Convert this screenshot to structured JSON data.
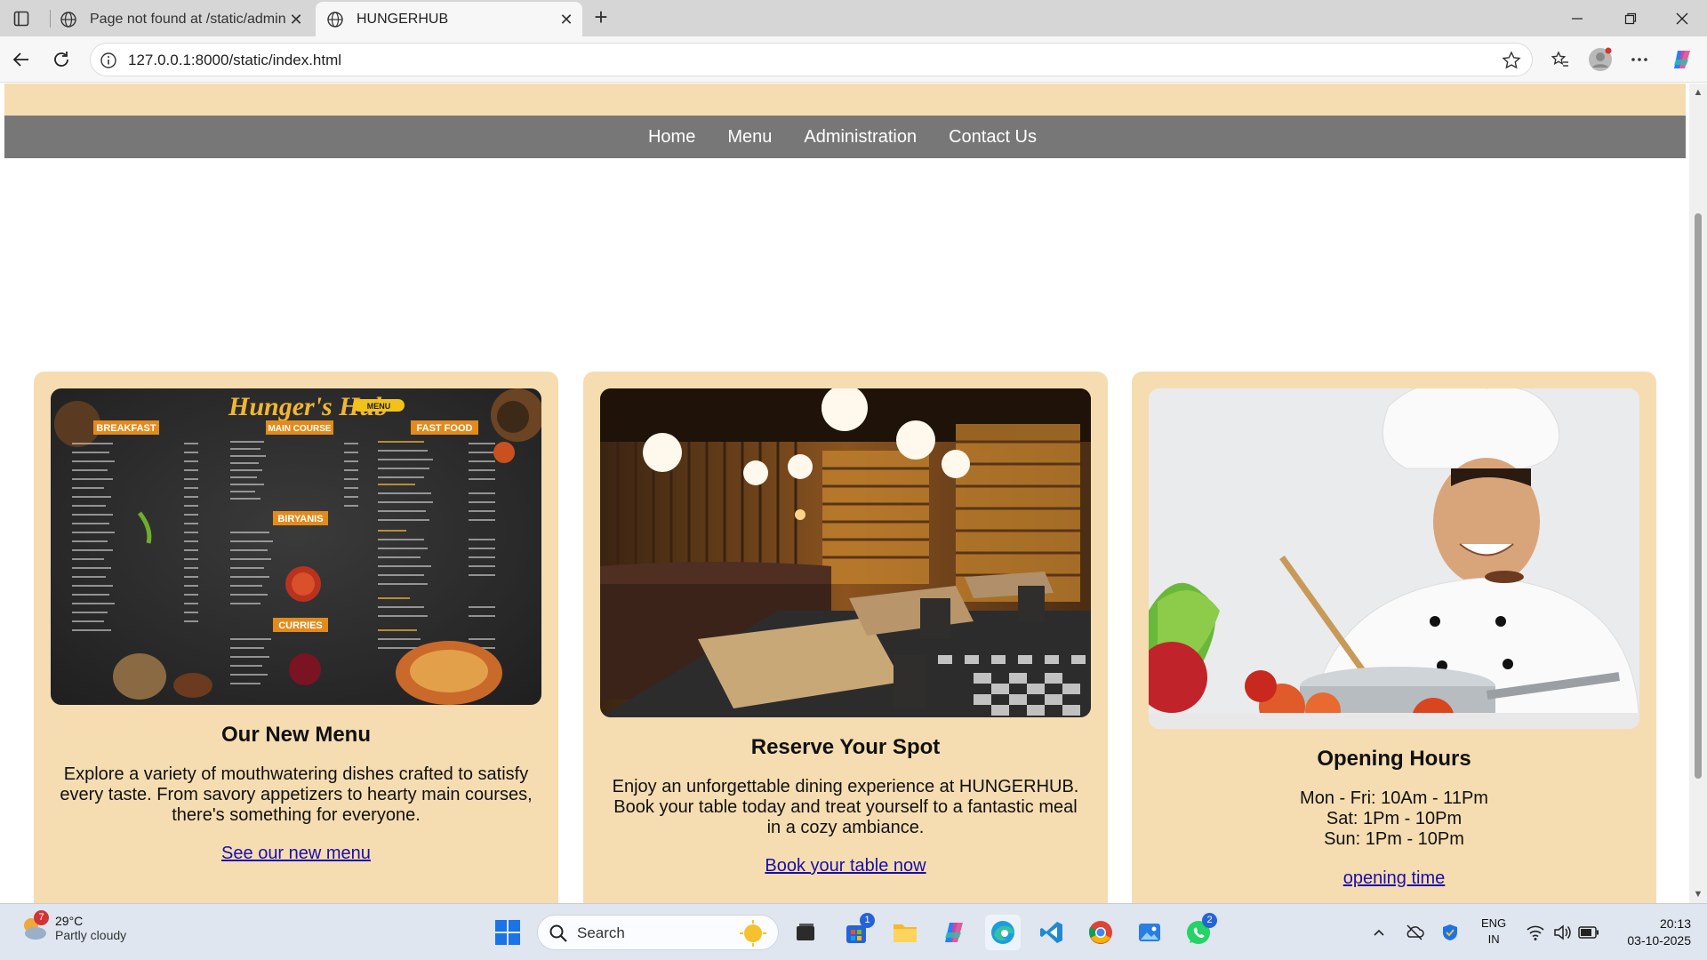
{
  "browser": {
    "tabs": [
      {
        "title": "Page not found at /static/adminstr",
        "active": false
      },
      {
        "title": "HUNGERHUB",
        "active": true
      }
    ],
    "url": "127.0.0.1:8000/static/index.html"
  },
  "nav": {
    "items": [
      "Home",
      "Menu",
      "Administration",
      "Contact Us"
    ]
  },
  "cards": [
    {
      "title": "Our New Menu",
      "text": "Explore a variety of mouthwatering dishes crafted to satisfy every taste. From savory appetizers to hearty main courses, there's something for everyone.",
      "link": "See our new menu",
      "image": "restaurant-menu-board-image"
    },
    {
      "title": "Reserve Your Spot",
      "text": "Enjoy an unforgettable dining experience at HUNGERHUB. Book your table today and treat yourself to a fantastic meal in a cozy ambiance.",
      "link": "Book your table now",
      "image": "restaurant-interior-image"
    },
    {
      "title": "Opening Hours",
      "hours": [
        "Mon - Fri: 10Am - 11Pm",
        "Sat: 1Pm - 10Pm",
        "Sun: 1Pm - 10Pm"
      ],
      "link": "opening time",
      "image": "chef-cooking-image"
    }
  ],
  "menu_image": {
    "brand": "Hunger's Hub",
    "badge": "MENU",
    "sections": [
      "BREAKFAST",
      "MAIN COURSE",
      "FAST FOOD",
      "BIRYANIS",
      "CURRIES"
    ]
  },
  "taskbar": {
    "weather": {
      "temp": "29°C",
      "condition": "Partly cloudy",
      "badge": "7"
    },
    "search_placeholder": "Search",
    "store_badge": "1",
    "whatsapp_badge": "2",
    "lang": "ENG",
    "region": "IN",
    "time": "20:13",
    "date": "03-10-2025"
  },
  "colors": {
    "card_bg": "#f5ddb1",
    "nav_bg": "#777777",
    "link": "#1a0dab"
  }
}
